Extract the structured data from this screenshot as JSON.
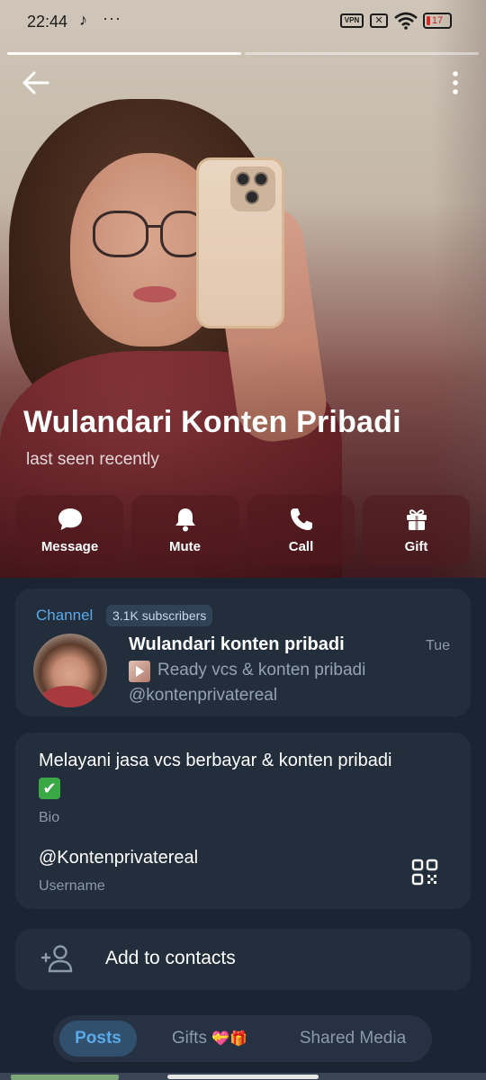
{
  "status_bar": {
    "time": "22:44",
    "tiktok_icon": "♪",
    "more": "···",
    "vpn": "VPN",
    "sim": "✕",
    "battery": "17"
  },
  "profile": {
    "name": "Wulandari Konten Pribadi",
    "status": "last seen recently"
  },
  "actions": [
    {
      "label": "Message",
      "icon": "message-icon"
    },
    {
      "label": "Mute",
      "icon": "bell-icon"
    },
    {
      "label": "Call",
      "icon": "phone-icon"
    },
    {
      "label": "Gift",
      "icon": "gift-icon"
    }
  ],
  "channel": {
    "label": "Channel",
    "subscribers": "3.1K subscribers",
    "title": "Wulandari konten pribadi",
    "time": "Tue",
    "preview_line1": "Ready vcs & konten pribadi",
    "preview_line2": "@kontenprivatereal"
  },
  "info": {
    "bio_text": "Melayani jasa vcs berbayar & konten pribadi",
    "bio_emoji": "✔",
    "bio_label": "Bio",
    "username": "@Kontenprivatereal",
    "username_label": "Username"
  },
  "add_contacts": {
    "label": "Add to contacts"
  },
  "tabs": {
    "posts": "Posts",
    "gifts": "Gifts",
    "gifts_emoji": "💝🎁",
    "media": "Shared Media"
  },
  "colors": {
    "accent": "#5aa9e8",
    "card_bg": "#232e3d",
    "page_bg": "#1b2433"
  }
}
